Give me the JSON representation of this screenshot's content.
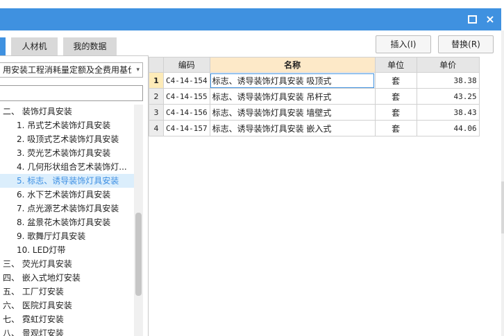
{
  "window": {
    "maximize_icon": "maximize-icon",
    "close_icon": "close-icon",
    "close_glyph": "×"
  },
  "tabs": [
    {
      "label": ""
    },
    {
      "label": "人材机"
    },
    {
      "label": "我的数据"
    }
  ],
  "toolbar": {
    "insert_label": "插入(I)",
    "replace_label": "替换(R)"
  },
  "quota_select": {
    "value": "用安装工程消耗量定额及全费用基价表",
    "arrow": "▾"
  },
  "search": {
    "value": "",
    "placeholder": ""
  },
  "tree": [
    {
      "label": "二、 装饰灯具安装",
      "indent": 0
    },
    {
      "label": "1. 吊式艺术装饰灯具安装",
      "indent": 1
    },
    {
      "label": "2. 吸顶式艺术装饰灯具安装",
      "indent": 1
    },
    {
      "label": "3. 荧光艺术装饰灯具安装",
      "indent": 1
    },
    {
      "label": "4. 几何形状组合艺术装饰灯...",
      "indent": 1
    },
    {
      "label": "5. 标志、诱导装饰灯具安装",
      "indent": 1,
      "selected": true
    },
    {
      "label": "6. 水下艺术装饰灯具安装",
      "indent": 1
    },
    {
      "label": "7. 点光源艺术装饰灯具安装",
      "indent": 1
    },
    {
      "label": "8. 盆景花木装饰灯具安装",
      "indent": 1
    },
    {
      "label": "9. 歌舞厅灯具安装",
      "indent": 1
    },
    {
      "label": "10. LED灯带",
      "indent": 1
    },
    {
      "label": "三、 荧光灯具安装",
      "indent": 0
    },
    {
      "label": "四、 嵌入式地灯安装",
      "indent": 0
    },
    {
      "label": "五、 工厂灯安装",
      "indent": 0
    },
    {
      "label": "六、 医院灯具安装",
      "indent": 0
    },
    {
      "label": "七、 霓虹灯安装",
      "indent": 0
    },
    {
      "label": "八、 景观灯安装",
      "indent": 0
    }
  ],
  "grid": {
    "headers": {
      "code": "编码",
      "name": "名称",
      "unit": "单位",
      "price": "单价"
    },
    "rows": [
      {
        "no": "1",
        "code": "C4-14-154",
        "name": "标志、诱导装饰灯具安装 吸顶式",
        "unit": "套",
        "price": "38.38"
      },
      {
        "no": "2",
        "code": "C4-14-155",
        "name": "标志、诱导装饰灯具安装 吊杆式",
        "unit": "套",
        "price": "43.25"
      },
      {
        "no": "3",
        "code": "C4-14-156",
        "name": "标志、诱导装饰灯具安装 墙壁式",
        "unit": "套",
        "price": "38.43"
      },
      {
        "no": "4",
        "code": "C4-14-157",
        "name": "标志、诱导装饰灯具安装 嵌入式",
        "unit": "套",
        "price": "44.06"
      }
    ]
  },
  "colors": {
    "titlebar": "#3f91e0",
    "selection_text": "#3d8fe3",
    "name_header": "#fde9c8"
  }
}
